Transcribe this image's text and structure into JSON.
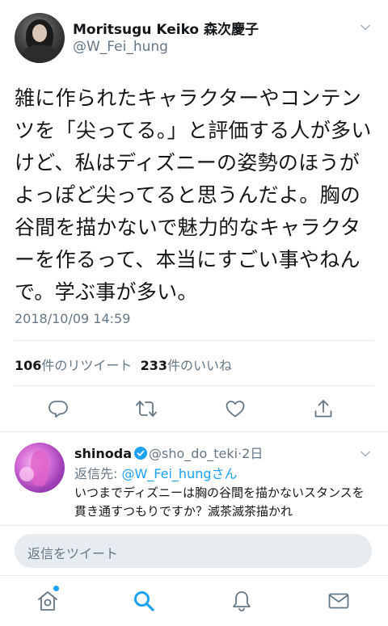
{
  "tweet": {
    "display_name": "Moritsugu Keiko 森次慶子",
    "handle": "@W_Fei_hung",
    "text": "雑に作られたキャラクターやコンテンツを「尖ってる。」と評価する人が多いけど、私はディズニーの姿勢のほうがよっぽど尖ってると思うんだよ。胸の谷間を描かないで魅力的なキャラクターを作るって、本当にすごい事やねんで。学ぶ事が多い。",
    "timestamp": "2018/10/09 14:59",
    "retweet_count": "106",
    "retweet_label": "件のリツイート",
    "like_count": "233",
    "like_label": "件のいいね"
  },
  "actions": [
    {
      "icon": "reply-icon"
    },
    {
      "icon": "retweet-icon"
    },
    {
      "icon": "like-icon"
    },
    {
      "icon": "share-icon"
    }
  ],
  "reply": {
    "name": "shinoda",
    "handle": "@sho_do_teki",
    "time": "2日",
    "reply_to_prefix": "返信先: ",
    "reply_to_handle": "@W_Fei_hungさん",
    "text": "いつまでディズニーは胸の谷間を描かないスタンスを貫き通すつもりですか？滅茶滅茶描かれ"
  },
  "composer": {
    "placeholder": "返信をツイート"
  },
  "tabbar": [
    {
      "icon": "home-icon"
    },
    {
      "icon": "search-icon"
    },
    {
      "icon": "notifications-icon"
    },
    {
      "icon": "messages-icon"
    }
  ],
  "colors": {
    "accent": "#1da1f2",
    "secondary_text": "#657786",
    "divider": "#e6ecf0"
  }
}
